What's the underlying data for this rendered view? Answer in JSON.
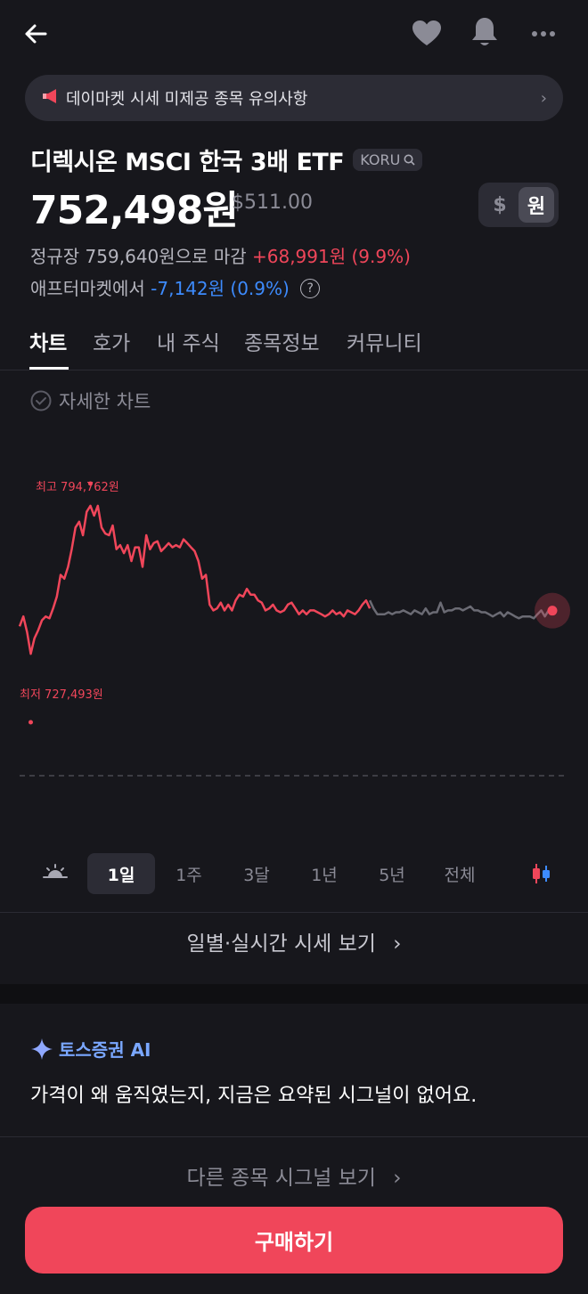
{
  "notice": {
    "text": "데이마켓 시세 미제공 종목 유의사항"
  },
  "stock": {
    "name": "디렉시온 MSCI 한국 3배 ETF",
    "ticker": "KORU",
    "price": "752,498원",
    "price_usd": "$511.00",
    "currency_usd": "$",
    "currency_krw": "원",
    "close_label": "정규장 759,640원으로 마감",
    "close_change": "+68,991원 (9.9%)",
    "after_label": "애프터마켓에서",
    "after_change": "-7,142원 (0.9%)",
    "help_symbol": "?"
  },
  "tabs": [
    "차트",
    "호가",
    "내 주식",
    "종목정보",
    "커뮤니티"
  ],
  "detail_chart_label": "자세한 차트",
  "chart": {
    "high_label": "최고 794,762원",
    "low_label": "최저 727,493원",
    "colors": {
      "regular": "#f0465a",
      "after": "#6b6b74"
    }
  },
  "chart_data": {
    "type": "line",
    "title": "",
    "xlabel": "",
    "ylabel": "",
    "ylim": [
      720000,
      800000
    ],
    "high": 794762,
    "low": 727493,
    "current": 752498,
    "series": [
      {
        "values": [
          746800,
          750400,
          744700,
          736800,
          742500,
          745400,
          749000,
          750400,
          749700,
          753300,
          757600,
          765500,
          764100,
          768400,
          774800,
          782700,
          784800,
          779900,
          788400,
          790600,
          787000,
          790600,
          782700,
          780500,
          779900,
          783400,
          774800,
          776300,
          773400,
          776300,
          770500,
          775500,
          775500,
          768400,
          779900,
          774800,
          777000,
          777700,
          774100,
          775500,
          777000,
          775500,
          776300,
          775500,
          778400,
          777000,
          775500,
          774100,
          770500,
          764100,
          765500,
          754700,
          752600,
          753300,
          755400,
          752600,
          754700,
          752600,
          756200,
          758300,
          757600,
          760400,
          758300,
          758300,
          756200,
          755400,
          752600,
          753300,
          754700,
          752600,
          751900,
          752600,
          754700,
          755400,
          753300,
          751200,
          752600,
          751200,
          752600,
          752600,
          751900,
          751200,
          750400,
          751200,
          752600,
          751200,
          751900,
          750400,
          752600,
          751900,
          751200,
          752600,
          754700,
          756200,
          753300
        ]
      },
      {
        "values": [
          756200,
          753300,
          751200,
          751200,
          751200,
          751900,
          751200,
          751900,
          751900,
          752600,
          751900,
          751200,
          752600,
          751900,
          751200,
          753300,
          751200,
          751900,
          751900,
          755400,
          751900,
          752600,
          752600,
          753300,
          753300,
          752600,
          753300,
          754000,
          752600,
          752600,
          751900,
          751900,
          751200,
          750400,
          751200,
          751900,
          750400,
          751900,
          751200,
          750400,
          749700,
          750400,
          750400,
          750400,
          749700,
          751200,
          752600,
          750400,
          752600,
          752498
        ]
      }
    ]
  },
  "periods": [
    "1일",
    "1주",
    "3달",
    "1년",
    "5년",
    "전체"
  ],
  "daily_link": "일별·실시간 시세 보기",
  "ai": {
    "title": "토스증권 AI",
    "message": "가격이 왜 움직였는지, 지금은 요약된 시그널이 없어요.",
    "other_link": "다른 종목 시그널 보기"
  },
  "buy_button": "구매하기"
}
